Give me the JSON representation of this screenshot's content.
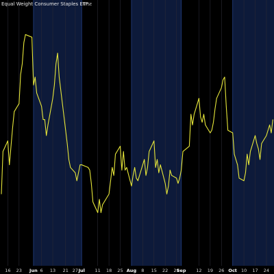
{
  "header": {
    "title": "Equal Weight Consumer Staples ETF",
    "exchange": "NYSE"
  },
  "colors": {
    "background": "#000000",
    "band_month_tint": "#0d1a3a",
    "grid_major": "#1f3a78",
    "grid_minor": "#2a2a36",
    "line": "#e8e83a",
    "tick_text": "#d8d8d8"
  },
  "chart_data": {
    "type": "line",
    "title": "Equal Weight Consumer Staples ETF",
    "exchange": "NYSE",
    "xlabel": "",
    "ylabel": "",
    "x_start": "2022-05-12",
    "grid": true,
    "alternating_month_bands": [
      "Jun",
      "Aug",
      "Oct"
    ],
    "x_ticks": [
      {
        "date": "2022-05-16",
        "label": "16",
        "month": false
      },
      {
        "date": "2022-05-23",
        "label": "23",
        "month": false
      },
      {
        "date": "2022-06-01",
        "label": "Jun",
        "month": true
      },
      {
        "date": "2022-06-06",
        "label": "6",
        "month": false
      },
      {
        "date": "2022-06-13",
        "label": "13",
        "month": false
      },
      {
        "date": "2022-06-21",
        "label": "21",
        "month": false
      },
      {
        "date": "2022-06-27",
        "label": "27",
        "month": false
      },
      {
        "date": "2022-07-01",
        "label": "Jul",
        "month": true
      },
      {
        "date": "2022-07-11",
        "label": "11",
        "month": false
      },
      {
        "date": "2022-07-18",
        "label": "18",
        "month": false
      },
      {
        "date": "2022-07-25",
        "label": "25",
        "month": false
      },
      {
        "date": "2022-08-01",
        "label": "Aug",
        "month": true
      },
      {
        "date": "2022-08-08",
        "label": "8",
        "month": false
      },
      {
        "date": "2022-08-15",
        "label": "15",
        "month": false
      },
      {
        "date": "2022-08-22",
        "label": "22",
        "month": false
      },
      {
        "date": "2022-08-29",
        "label": "29",
        "month": false
      },
      {
        "date": "2022-09-01",
        "label": "Sep",
        "month": true
      },
      {
        "date": "2022-09-12",
        "label": "12",
        "month": false
      },
      {
        "date": "2022-09-19",
        "label": "19",
        "month": false
      },
      {
        "date": "2022-09-26",
        "label": "26",
        "month": false
      },
      {
        "date": "2022-10-03",
        "label": "Oct",
        "month": true
      },
      {
        "date": "2022-10-10",
        "label": "10",
        "month": false
      },
      {
        "date": "2022-10-17",
        "label": "17",
        "month": false
      },
      {
        "date": "2022-10-24",
        "label": "24",
        "month": false
      }
    ],
    "ylim": [
      0,
      100
    ],
    "series": [
      {
        "name": "",
        "points": [
          [
            "2022-05-12",
            27
          ],
          [
            "2022-05-13",
            43
          ],
          [
            "2022-05-16",
            47
          ],
          [
            "2022-05-17",
            38
          ],
          [
            "2022-05-18",
            45
          ],
          [
            "2022-05-19",
            52
          ],
          [
            "2022-05-20",
            58
          ],
          [
            "2022-05-23",
            61
          ],
          [
            "2022-05-24",
            72
          ],
          [
            "2022-05-25",
            76
          ],
          [
            "2022-05-26",
            84
          ],
          [
            "2022-05-27",
            87
          ],
          [
            "2022-05-31",
            86
          ],
          [
            "2022-06-01",
            68
          ],
          [
            "2022-06-02",
            71
          ],
          [
            "2022-06-03",
            65
          ],
          [
            "2022-06-06",
            60
          ],
          [
            "2022-06-07",
            55
          ],
          [
            "2022-06-08",
            55
          ],
          [
            "2022-06-09",
            49
          ],
          [
            "2022-06-10",
            53
          ],
          [
            "2022-06-13",
            63
          ],
          [
            "2022-06-14",
            68
          ],
          [
            "2022-06-15",
            76
          ],
          [
            "2022-06-16",
            80
          ],
          [
            "2022-06-17",
            71
          ],
          [
            "2022-06-21",
            51
          ],
          [
            "2022-06-22",
            46
          ],
          [
            "2022-06-23",
            40
          ],
          [
            "2022-06-24",
            37
          ],
          [
            "2022-06-27",
            35
          ],
          [
            "2022-06-28",
            32
          ],
          [
            "2022-06-29",
            35
          ],
          [
            "2022-06-30",
            38
          ],
          [
            "2022-07-01",
            38
          ],
          [
            "2022-07-05",
            37
          ],
          [
            "2022-07-06",
            36
          ],
          [
            "2022-07-07",
            31
          ],
          [
            "2022-07-08",
            24
          ],
          [
            "2022-07-11",
            20
          ],
          [
            "2022-07-12",
            25
          ],
          [
            "2022-07-13",
            20
          ],
          [
            "2022-07-14",
            23
          ],
          [
            "2022-07-15",
            24
          ],
          [
            "2022-07-18",
            27
          ],
          [
            "2022-07-19",
            32
          ],
          [
            "2022-07-20",
            37
          ],
          [
            "2022-07-21",
            34
          ],
          [
            "2022-07-22",
            42
          ],
          [
            "2022-07-25",
            45
          ],
          [
            "2022-07-26",
            36
          ],
          [
            "2022-07-27",
            43
          ],
          [
            "2022-07-28",
            36
          ],
          [
            "2022-07-29",
            37
          ],
          [
            "2022-08-01",
            30
          ],
          [
            "2022-08-02",
            34
          ],
          [
            "2022-08-03",
            37
          ],
          [
            "2022-08-04",
            33
          ],
          [
            "2022-08-05",
            32
          ],
          [
            "2022-08-08",
            38
          ],
          [
            "2022-08-09",
            40
          ],
          [
            "2022-08-10",
            34
          ],
          [
            "2022-08-11",
            37
          ],
          [
            "2022-08-12",
            43
          ],
          [
            "2022-08-15",
            47
          ],
          [
            "2022-08-16",
            37
          ],
          [
            "2022-08-17",
            40
          ],
          [
            "2022-08-18",
            35
          ],
          [
            "2022-08-19",
            38
          ],
          [
            "2022-08-22",
            31
          ],
          [
            "2022-08-23",
            27
          ],
          [
            "2022-08-24",
            30
          ],
          [
            "2022-08-25",
            36
          ],
          [
            "2022-08-26",
            34
          ],
          [
            "2022-08-29",
            33
          ],
          [
            "2022-08-30",
            31
          ],
          [
            "2022-08-31",
            33
          ],
          [
            "2022-09-01",
            36
          ],
          [
            "2022-09-02",
            43
          ],
          [
            "2022-09-06",
            45
          ],
          [
            "2022-09-07",
            57
          ],
          [
            "2022-09-08",
            53
          ],
          [
            "2022-09-09",
            57
          ],
          [
            "2022-09-12",
            63
          ],
          [
            "2022-09-13",
            56
          ],
          [
            "2022-09-14",
            54
          ],
          [
            "2022-09-15",
            57
          ],
          [
            "2022-09-16",
            53
          ],
          [
            "2022-09-19",
            50
          ],
          [
            "2022-09-20",
            51
          ],
          [
            "2022-09-21",
            54
          ],
          [
            "2022-09-22",
            59
          ],
          [
            "2022-09-23",
            63
          ],
          [
            "2022-09-26",
            67
          ],
          [
            "2022-09-27",
            70
          ],
          [
            "2022-09-28",
            71
          ],
          [
            "2022-09-29",
            60
          ],
          [
            "2022-09-30",
            51
          ],
          [
            "2022-10-03",
            50
          ],
          [
            "2022-10-04",
            42
          ],
          [
            "2022-10-05",
            40
          ],
          [
            "2022-10-06",
            38
          ],
          [
            "2022-10-07",
            33
          ],
          [
            "2022-10-10",
            32
          ],
          [
            "2022-10-11",
            35
          ],
          [
            "2022-10-12",
            42
          ],
          [
            "2022-10-13",
            38
          ],
          [
            "2022-10-14",
            43
          ],
          [
            "2022-10-17",
            49
          ],
          [
            "2022-10-18",
            46
          ],
          [
            "2022-10-19",
            44
          ],
          [
            "2022-10-20",
            40
          ],
          [
            "2022-10-21",
            46
          ],
          [
            "2022-10-24",
            49
          ],
          [
            "2022-10-25",
            51
          ],
          [
            "2022-10-26",
            53
          ],
          [
            "2022-10-27",
            50
          ],
          [
            "2022-10-28",
            55
          ]
        ]
      }
    ]
  }
}
